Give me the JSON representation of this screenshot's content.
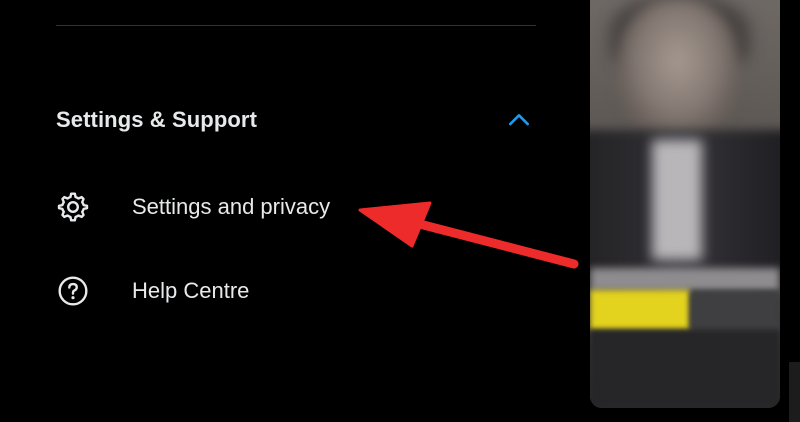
{
  "menu": {
    "section_title": "Settings & Support",
    "items": [
      {
        "label": "Settings and privacy",
        "icon": "gear-icon"
      },
      {
        "label": "Help Centre",
        "icon": "help-circle-icon"
      }
    ]
  },
  "colors": {
    "background": "#000000",
    "text": "#e7e9ea",
    "accent": "#1d9bf0",
    "divider": "#2f3336",
    "annotation_arrow": "#ee2b2b"
  }
}
